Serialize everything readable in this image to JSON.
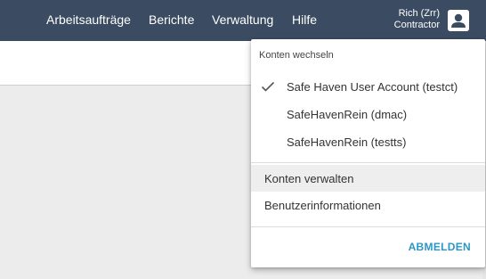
{
  "nav": {
    "items": [
      "Arbeitsaufträge",
      "Berichte",
      "Verwaltung",
      "Hilfe"
    ]
  },
  "user": {
    "name": "Rich (Zrr)",
    "role": "Contractor",
    "avatar_icon": "user-avatar-icon"
  },
  "menu": {
    "header": "Konten wechseln",
    "accounts": [
      {
        "label": "Safe Haven User Account (testct)",
        "selected": true
      },
      {
        "label": "SafeHavenRein (dmac)",
        "selected": false
      },
      {
        "label": "SafeHavenRein (testts)",
        "selected": false
      }
    ],
    "actions": [
      {
        "label": "Konten verwalten",
        "highlighted": true
      },
      {
        "label": "Benutzerinformationen",
        "highlighted": false
      }
    ],
    "logout": "ABMELDEN"
  },
  "colors": {
    "topbar": "#3b4b61",
    "accent": "#2a97c9"
  }
}
